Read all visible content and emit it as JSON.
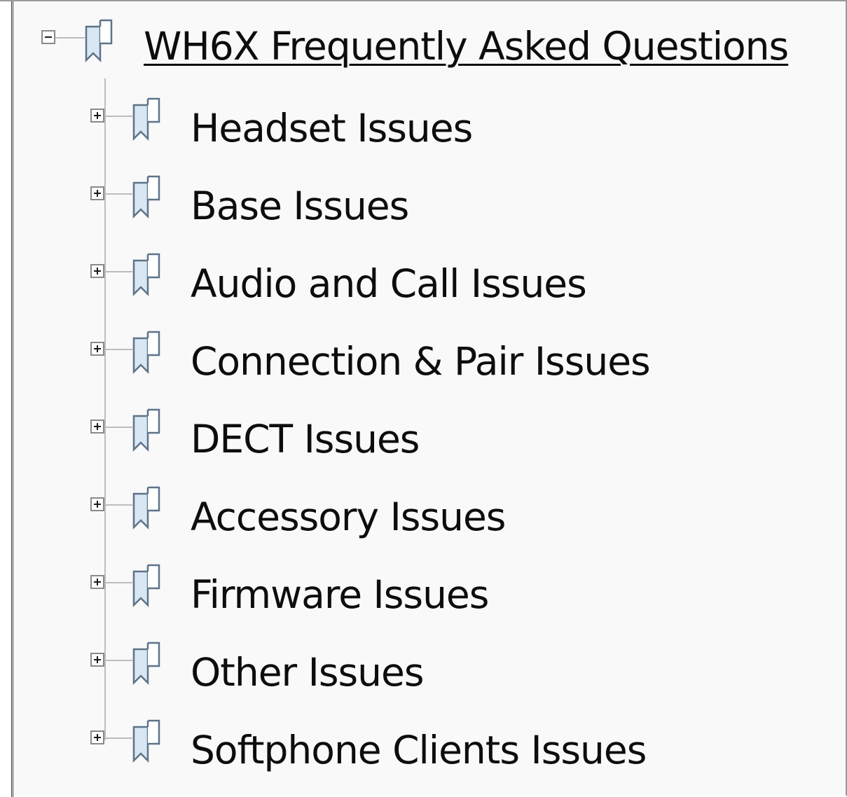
{
  "tree": {
    "root": {
      "label": "WH6X Frequently Asked Questions",
      "expanded": true,
      "icon": "bookmark-icon"
    },
    "children": [
      {
        "label": "Headset Issues",
        "expanded": false,
        "icon": "bookmark-icon"
      },
      {
        "label": "Base Issues",
        "expanded": false,
        "icon": "bookmark-icon"
      },
      {
        "label": "Audio and Call Issues",
        "expanded": false,
        "icon": "bookmark-icon"
      },
      {
        "label": "Connection & Pair Issues",
        "expanded": false,
        "icon": "bookmark-icon"
      },
      {
        "label": "DECT Issues",
        "expanded": false,
        "icon": "bookmark-icon"
      },
      {
        "label": "Accessory Issues",
        "expanded": false,
        "icon": "bookmark-icon"
      },
      {
        "label": "Firmware Issues",
        "expanded": false,
        "icon": "bookmark-icon"
      },
      {
        "label": "Other Issues",
        "expanded": false,
        "icon": "bookmark-icon"
      },
      {
        "label": "Softphone Clients Issues",
        "expanded": false,
        "icon": "bookmark-icon"
      }
    ]
  },
  "colors": {
    "panel_background": "#f9f9f9",
    "text": "#0d0d0d",
    "tree_line": "#bdbdbd",
    "bookmark_fill": "#d8e7f3",
    "bookmark_stroke": "#5d7389"
  }
}
